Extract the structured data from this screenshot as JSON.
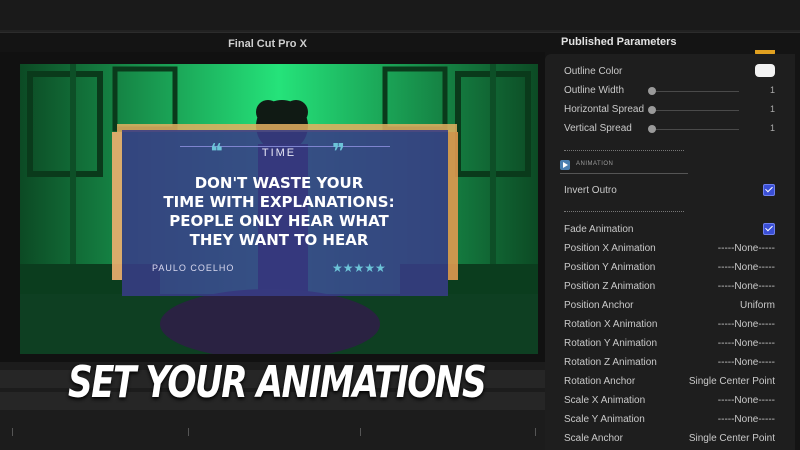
{
  "app": {
    "title": "Final Cut Pro X"
  },
  "viewer": {
    "quote_header": "TIME",
    "quote_lines": [
      "DON'T WASTE YOUR",
      "TIME WITH EXPLANATIONS:",
      "PEOPLE ONLY HEAR WHAT",
      "THEY WANT TO HEAR"
    ],
    "author": "PAULO COELHO",
    "rating": "★★★★★"
  },
  "caption": "SET YOUR ANIMATIONS",
  "panel": {
    "title": "Published Parameters",
    "outline_color_label": "Outline Color",
    "outline_width": {
      "label": "Outline Width",
      "value": "1"
    },
    "horizontal_spread": {
      "label": "Horizontal Spread",
      "value": "1"
    },
    "vertical_spread": {
      "label": "Vertical Spread",
      "value": "1"
    },
    "section_label": "ANIMATION",
    "invert_outro": {
      "label": "Invert Outro",
      "checked": true
    },
    "fade_animation": {
      "label": "Fade Animation",
      "checked": true
    },
    "rows": [
      {
        "label": "Position X Animation",
        "value": "-----None-----"
      },
      {
        "label": "Position Y Animation",
        "value": "-----None-----"
      },
      {
        "label": "Position Z Animation",
        "value": "-----None-----"
      },
      {
        "label": "Position Anchor",
        "value": "Uniform"
      },
      {
        "label": "Rotation X Animation",
        "value": "-----None-----"
      },
      {
        "label": "Rotation Y Animation",
        "value": "-----None-----"
      },
      {
        "label": "Rotation Z Animation",
        "value": "-----None-----"
      },
      {
        "label": "Rotation Anchor",
        "value": "Single Center Point"
      },
      {
        "label": "Scale X Animation",
        "value": "-----None-----"
      },
      {
        "label": "Scale Y Animation",
        "value": "-----None-----"
      },
      {
        "label": "Scale Anchor",
        "value": "Single Center Point"
      }
    ]
  },
  "colors": {
    "accent_checkbox": "#3a4fd6",
    "viewer_green": "#1fd36a",
    "quote_box": "#3b3f8a"
  }
}
